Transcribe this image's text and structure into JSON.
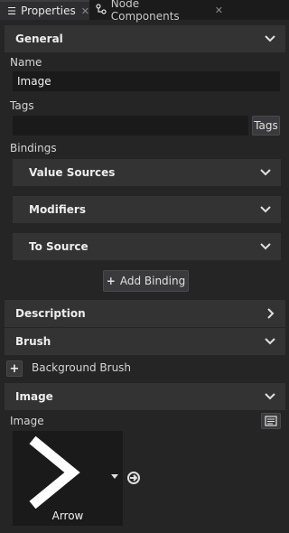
{
  "tabs": [
    {
      "label": "Properties",
      "icon": "properties-list-icon",
      "active": true
    },
    {
      "label": "Node Components",
      "icon": "node-components-icon",
      "active": false
    }
  ],
  "sections": {
    "general": "General",
    "description": "Description",
    "brush": "Brush",
    "image": "Image"
  },
  "general": {
    "name_label": "Name",
    "name_value": "Image",
    "tags_label": "Tags",
    "tags_value": "",
    "tags_button": "Tags",
    "bindings_label": "Bindings",
    "bindings_groups": [
      "Value Sources",
      "Modifiers",
      "To Source"
    ],
    "add_binding": "Add Binding"
  },
  "brush": {
    "background_brush": "Background Brush"
  },
  "image": {
    "image_label": "Image",
    "preview_caption": "Arrow"
  },
  "colors": {
    "background": "#252526",
    "section": "#333334",
    "field": "#1a1a1a",
    "text": "#dcdcdc"
  }
}
